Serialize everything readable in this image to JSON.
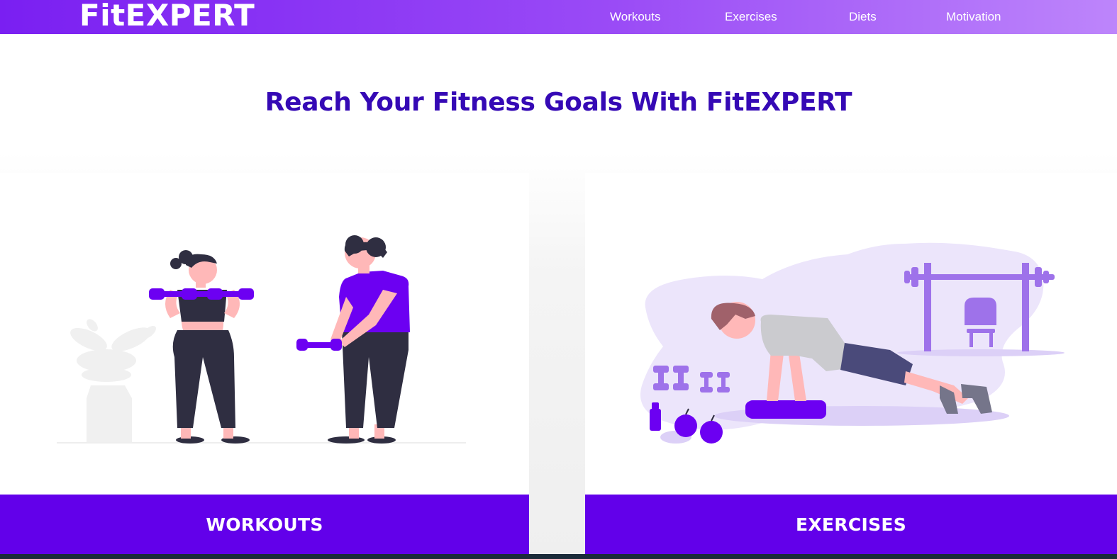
{
  "brand": {
    "logo": "FitEXPERT"
  },
  "nav": {
    "items": [
      {
        "label": "Workouts"
      },
      {
        "label": "Exercises"
      },
      {
        "label": "Diets"
      },
      {
        "label": "Motivation"
      }
    ]
  },
  "hero": {
    "headline": "Reach Your Fitness Goals With FitEXPERT"
  },
  "cards": [
    {
      "title": "WORKOUTS",
      "illustration": "two-people-lifting-dumbbells"
    },
    {
      "title": "EXERCISES",
      "illustration": "man-doing-plank-with-gym-equipment"
    }
  ],
  "colors": {
    "brand_purple": "#6200ea",
    "headline": "#3509b5",
    "nav_gradient_start": "#7a1ff2",
    "nav_gradient_end": "#bd85fb"
  }
}
